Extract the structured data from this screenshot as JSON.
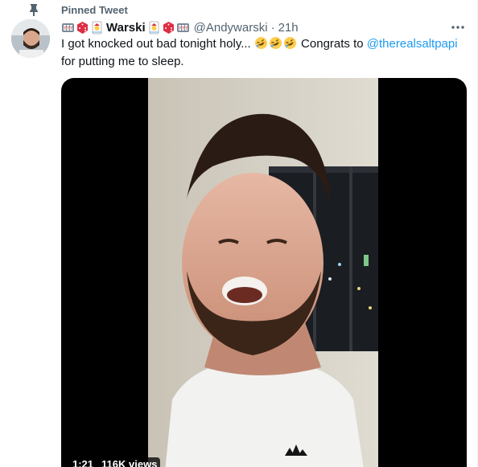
{
  "pinned": {
    "label": "Pinned Tweet",
    "icon": "pin-icon"
  },
  "author": {
    "display_name": "Warski",
    "handle": "@Andywarski",
    "separator": "·",
    "time": "21h",
    "name_emojis_before": [
      "slot-machine-emoji",
      "dice-emoji",
      "joker-emoji"
    ],
    "name_emojis_after": [
      "joker-emoji",
      "dice-emoji",
      "slot-machine-emoji"
    ]
  },
  "tweet": {
    "text_before_emojis": "I got knocked out bad tonight holy... ",
    "emojis": [
      "rofl-emoji",
      "rofl-emoji",
      "rofl-emoji"
    ],
    "text_after_emojis": " Congrats to ",
    "mention": "@therealsaltpapi",
    "text_line2": "for putting me to sleep."
  },
  "video": {
    "duration": "1:21",
    "views": "116K views"
  },
  "colors": {
    "text": "#0f1419",
    "secondary": "#536471",
    "link": "#1d9bf0",
    "media_bg": "#000000"
  }
}
